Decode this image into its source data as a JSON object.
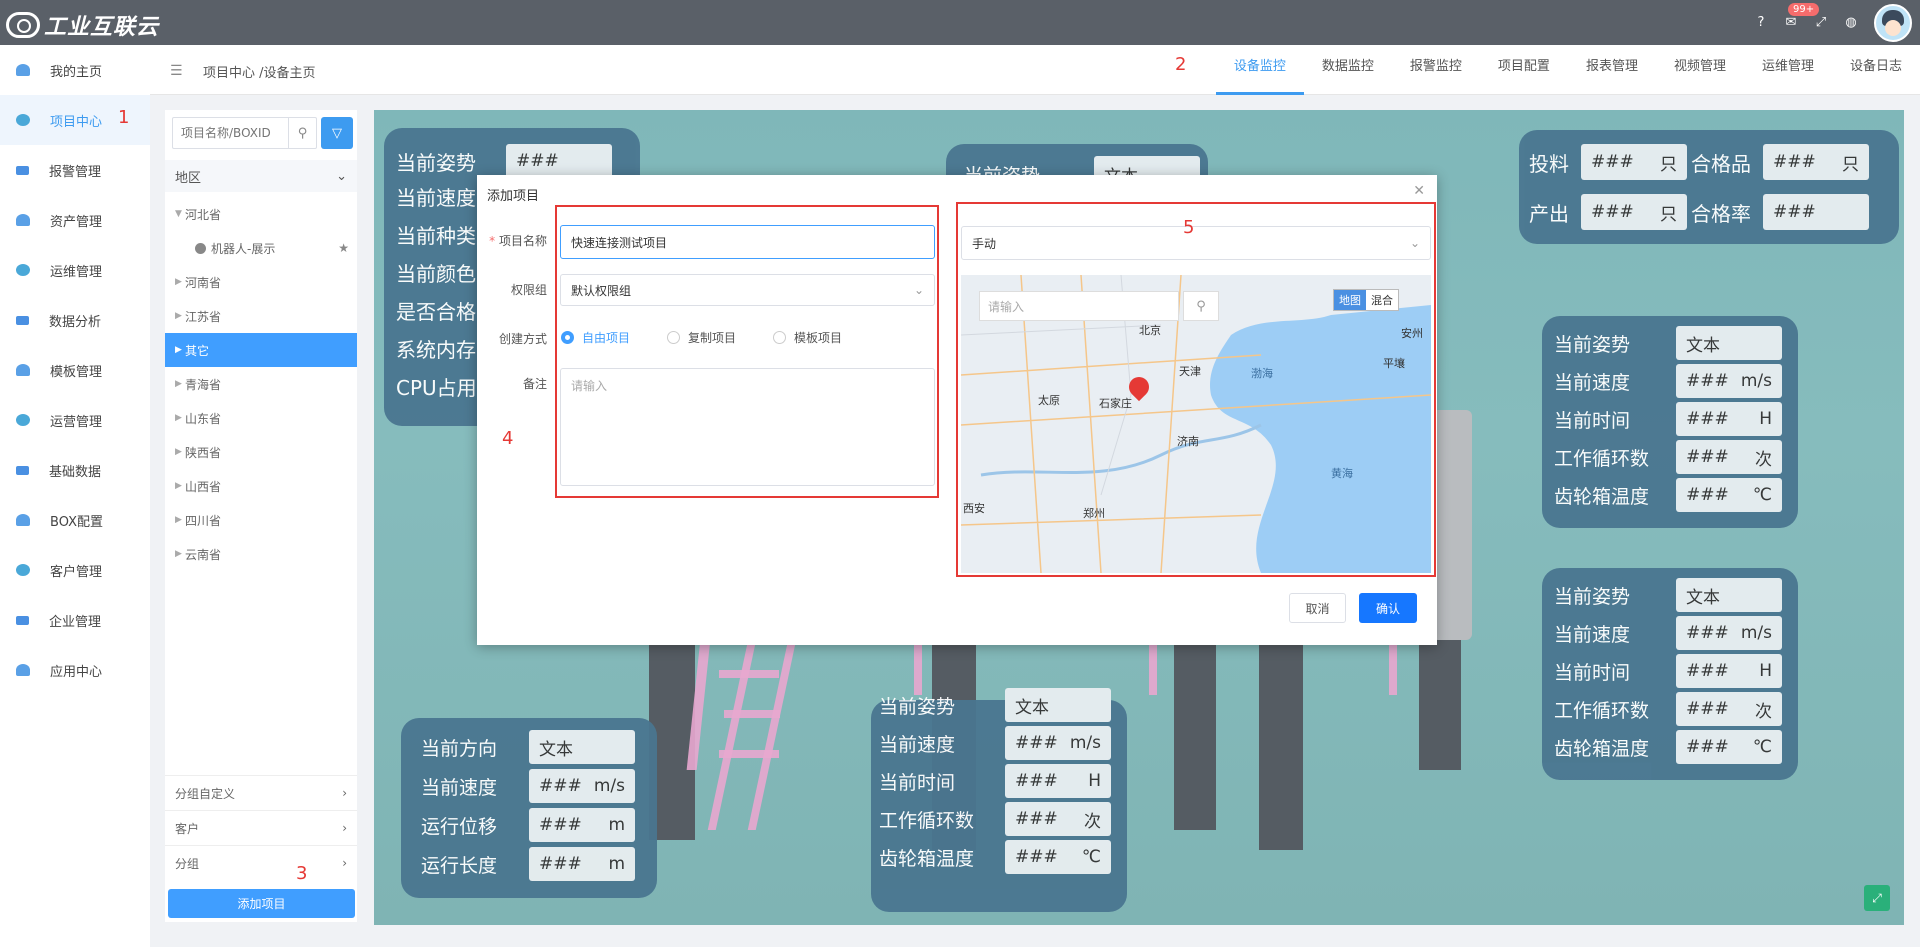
{
  "app": {
    "logo_text": "工业互联云",
    "notification_count": "99+"
  },
  "topbar_icons": [
    "help-icon",
    "mail-icon",
    "fullscreen-icon",
    "language-icon"
  ],
  "sidebar": {
    "items": [
      {
        "label": "我的主页",
        "icon": "home-icon"
      },
      {
        "label": "项目中心",
        "icon": "project-icon",
        "active": true
      },
      {
        "label": "报警管理",
        "icon": "alarm-icon"
      },
      {
        "label": "资产管理",
        "icon": "asset-icon"
      },
      {
        "label": "运维管理",
        "icon": "maintenance-icon"
      },
      {
        "label": "数据分析",
        "icon": "analytics-icon"
      },
      {
        "label": "模板管理",
        "icon": "template-icon"
      },
      {
        "label": "运营管理",
        "icon": "operations-icon"
      },
      {
        "label": "基础数据",
        "icon": "database-icon"
      },
      {
        "label": "BOX配置",
        "icon": "box-icon"
      },
      {
        "label": "客户管理",
        "icon": "customer-icon"
      },
      {
        "label": "企业管理",
        "icon": "enterprise-icon"
      },
      {
        "label": "应用中心",
        "icon": "apps-icon"
      }
    ]
  },
  "header": {
    "breadcrumb": "项目中心 /设备主页",
    "tabs": [
      "设备监控",
      "数据监控",
      "报警监控",
      "项目配置",
      "报表管理",
      "视频管理",
      "运维管理",
      "设备日志"
    ],
    "active_tab": "设备监控"
  },
  "left_panel": {
    "search_placeholder": "项目名称/BOXID",
    "region_label": "地区",
    "tree": [
      {
        "label": "河北省",
        "expanded": true
      },
      {
        "label": "机器人-展示",
        "child": true
      },
      {
        "label": "河南省"
      },
      {
        "label": "江苏省"
      },
      {
        "label": "其它",
        "selected": true
      },
      {
        "label": "青海省"
      },
      {
        "label": "山东省"
      },
      {
        "label": "陕西省"
      },
      {
        "label": "山西省"
      },
      {
        "label": "四川省"
      },
      {
        "label": "云南省"
      }
    ],
    "groups": [
      "分组自定义",
      "客户",
      "分组"
    ],
    "add_button": "添加项目"
  },
  "annotations": [
    "1",
    "2",
    "3",
    "4",
    "5"
  ],
  "cards": {
    "topleft": {
      "rows": [
        {
          "label": "当前姿势",
          "value": "###",
          "unit": ""
        },
        {
          "label": "当前速度",
          "value": "",
          "unit": ""
        },
        {
          "label": "当前种类",
          "value": "",
          "unit": ""
        },
        {
          "label": "当前颜色",
          "value": "",
          "unit": ""
        },
        {
          "label": "是否合格",
          "value": "",
          "unit": ""
        },
        {
          "label": "系统内存",
          "value": "",
          "unit": ""
        },
        {
          "label": "CPU占用",
          "value": "",
          "unit": ""
        }
      ]
    },
    "topmid": {
      "label": "当前姿势",
      "value": "文本"
    },
    "topright": {
      "rows": [
        {
          "label": "投料",
          "value": "###",
          "unit": "只"
        },
        {
          "label": "合格品",
          "value": "###",
          "unit": "只"
        },
        {
          "label": "产出",
          "value": "###",
          "unit": "只"
        },
        {
          "label": "合格率",
          "value": "###",
          "unit": ""
        }
      ]
    },
    "right1": {
      "rows": [
        {
          "label": "当前姿势",
          "value": "文本",
          "unit": ""
        },
        {
          "label": "当前速度",
          "value": "###",
          "unit": "m/s"
        },
        {
          "label": "当前时间",
          "value": "###",
          "unit": "H"
        },
        {
          "label": "工作循环数",
          "value": "###",
          "unit": "次"
        },
        {
          "label": "齿轮箱温度",
          "value": "###",
          "unit": "℃"
        }
      ]
    },
    "right2": {
      "rows": [
        {
          "label": "当前姿势",
          "value": "文本",
          "unit": ""
        },
        {
          "label": "当前速度",
          "value": "###",
          "unit": "m/s"
        },
        {
          "label": "当前时间",
          "value": "###",
          "unit": "H"
        },
        {
          "label": "工作循环数",
          "value": "###",
          "unit": "次"
        },
        {
          "label": "齿轮箱温度",
          "value": "###",
          "unit": "℃"
        }
      ]
    },
    "bottomleft": {
      "rows": [
        {
          "label": "当前方向",
          "value": "文本",
          "unit": ""
        },
        {
          "label": "当前速度",
          "value": "###",
          "unit": "m/s"
        },
        {
          "label": "运行位移",
          "value": "###",
          "unit": "m"
        },
        {
          "label": "运行长度",
          "value": "###",
          "unit": "m"
        }
      ]
    },
    "bottommid": {
      "rows": [
        {
          "label": "当前姿势",
          "value": "文本",
          "unit": ""
        },
        {
          "label": "当前速度",
          "value": "###",
          "unit": "m/s"
        },
        {
          "label": "当前时间",
          "value": "###",
          "unit": "H"
        },
        {
          "label": "工作循环数",
          "value": "###",
          "unit": "次"
        },
        {
          "label": "齿轮箱温度",
          "value": "###",
          "unit": "℃"
        }
      ]
    }
  },
  "modal": {
    "title": "添加项目",
    "fields": {
      "name_label": "项目名称",
      "name_value": "快速连接测试项目",
      "perm_label": "权限组",
      "perm_value": "默认权限组",
      "mode_label": "创建方式",
      "modes": [
        "自由项目",
        "复制项目",
        "模板项目"
      ],
      "mode_selected": "自由项目",
      "remark_label": "备注",
      "remark_placeholder": "请输入"
    },
    "location_mode": "手动",
    "map": {
      "search_placeholder": "请输入",
      "type_buttons": [
        "地图",
        "混合"
      ],
      "active_type": "地图",
      "labels": [
        "北京",
        "天津",
        "渤海",
        "太原",
        "石家庄",
        "济南",
        "郑州",
        "黄海",
        "平壤",
        "安州",
        "西安"
      ]
    },
    "cancel": "取消",
    "confirm": "确认"
  }
}
